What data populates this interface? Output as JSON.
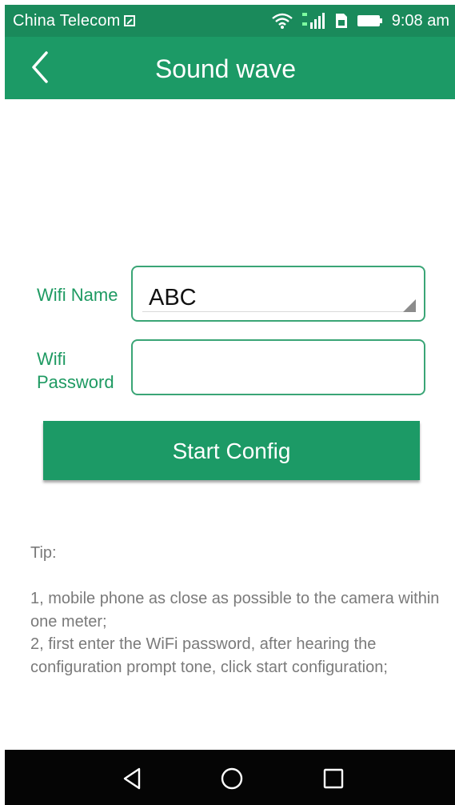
{
  "status_bar": {
    "carrier": "China Telecom",
    "time": "9:08 am",
    "icons": [
      "image-notification-icon",
      "wifi-icon",
      "signal-icon",
      "sim-card-icon",
      "battery-icon"
    ]
  },
  "header": {
    "title": "Sound wave",
    "back_icon": "chevron-left-icon"
  },
  "form": {
    "wifi_name_label": "Wifi Name",
    "wifi_name_value": "ABC",
    "wifi_password_label": "Wifi Password",
    "wifi_password_value": ""
  },
  "start_button": {
    "label": "Start Config"
  },
  "tips": {
    "title": "Tip:",
    "line1": "1, mobile phone as close as possible to the camera within one meter;",
    "line2": "2, first enter the WiFi password, after hearing the configuration prompt tone, click start configuration;"
  },
  "nav_bar": {
    "icons": [
      "nav-back-icon",
      "nav-home-icon",
      "nav-recent-icon"
    ]
  },
  "colors": {
    "status_bar": "#1a8a5b",
    "header": "#1c9a66",
    "accent": "#1e9a62",
    "field_border": "#3aa576",
    "tip_text": "#7a7a7a",
    "nav_bar": "#050505"
  }
}
